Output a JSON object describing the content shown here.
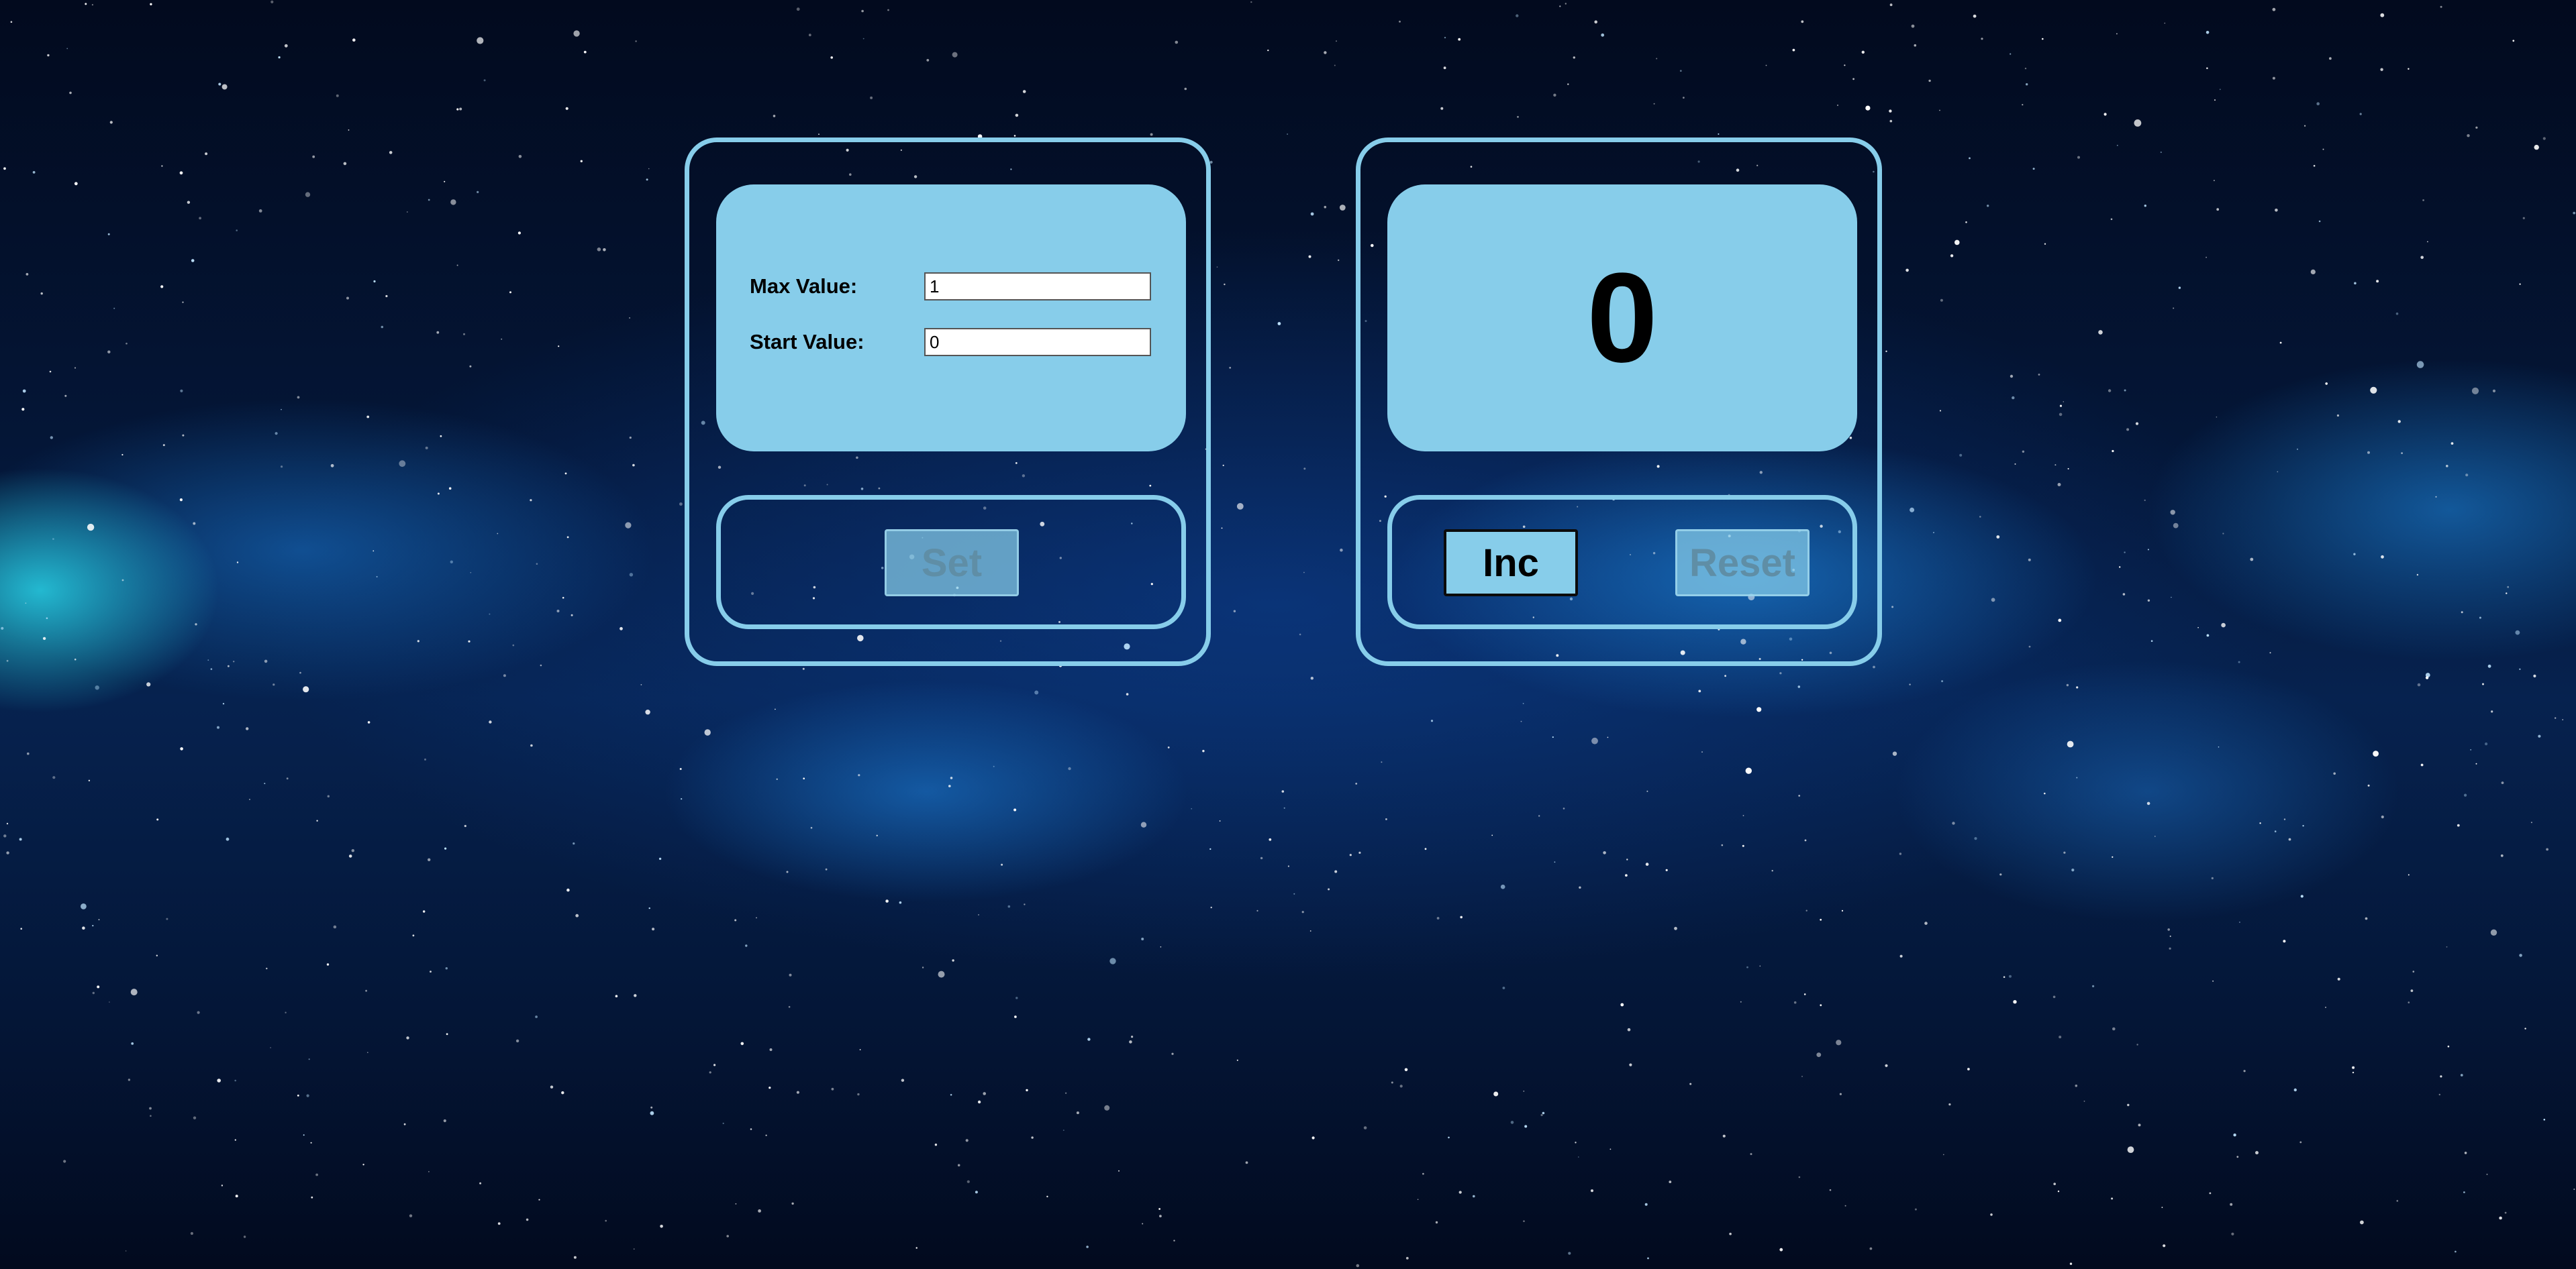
{
  "settings": {
    "max_label": "Max Value:",
    "max_value": "1",
    "start_label": "Start Value:",
    "start_value": "0",
    "set_label": "Set"
  },
  "counter": {
    "value": "0",
    "inc_label": "Inc",
    "reset_label": "Reset"
  },
  "colors": {
    "panel_accent": "#87cdea",
    "background": "#041637"
  }
}
